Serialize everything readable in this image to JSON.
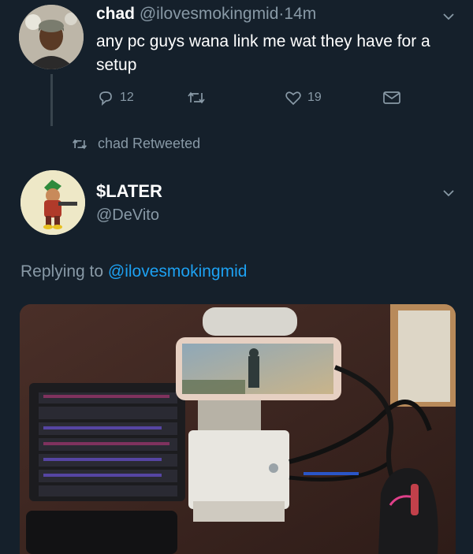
{
  "tweet1": {
    "name": "chad",
    "handle": "@ilovesmokingmid",
    "separator": "·",
    "time": "14m",
    "text": "any pc guys wana link me wat they have for a setup",
    "reply_count": "12",
    "retweet_count": "",
    "like_count": "19"
  },
  "retweet_banner": {
    "text": "chad Retweeted"
  },
  "tweet2": {
    "name": "$LATER",
    "handle": "@DeVito",
    "replying_prefix": "Replying to",
    "replying_handle": "@ilovesmokingmid"
  },
  "icons": {
    "reply": "reply-icon",
    "retweet": "retweet-icon",
    "like": "heart-icon",
    "share": "mail-icon",
    "more": "chevron-down-icon"
  },
  "colors": {
    "background": "#15202b",
    "muted": "#8899a6",
    "link": "#1da1f2",
    "thread_line": "#38444d"
  }
}
